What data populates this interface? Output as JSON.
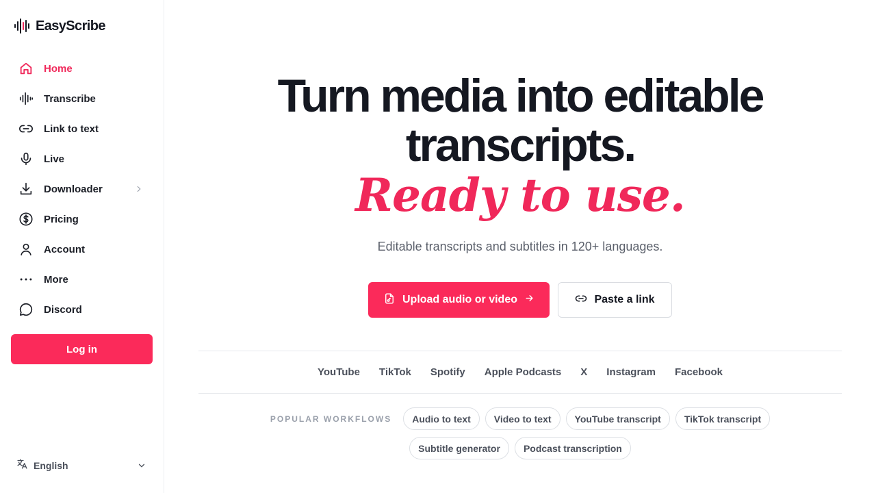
{
  "brand": {
    "name": "EasyScribe",
    "accent": "#fb2a5a"
  },
  "sidebar": {
    "items": [
      {
        "label": "Home",
        "icon": "home-icon",
        "active": true
      },
      {
        "label": "Transcribe",
        "icon": "waveform-icon"
      },
      {
        "label": "Link to text",
        "icon": "link-icon"
      },
      {
        "label": "Live",
        "icon": "microphone-icon"
      },
      {
        "label": "Downloader",
        "icon": "download-icon",
        "has_submenu": true
      },
      {
        "label": "Pricing",
        "icon": "dollar-circle-icon"
      },
      {
        "label": "Account",
        "icon": "user-icon"
      },
      {
        "label": "More",
        "icon": "more-dots-icon"
      },
      {
        "label": "Discord",
        "icon": "chat-bubble-icon"
      }
    ],
    "login_label": "Log in",
    "language": "English"
  },
  "hero": {
    "line1": "Turn media into editable",
    "line2": "transcripts.",
    "tagline": "Ready to use.",
    "subtitle": "Editable transcripts and subtitles in 120+ languages."
  },
  "cta": {
    "upload_label": "Upload audio or video",
    "paste_label": "Paste a link"
  },
  "platforms": [
    "YouTube",
    "TikTok",
    "Spotify",
    "Apple Podcasts",
    "X",
    "Instagram",
    "Facebook"
  ],
  "workflows": {
    "label": "POPULAR WORKFLOWS",
    "items": [
      "Audio to text",
      "Video to text",
      "YouTube transcript",
      "TikTok transcript",
      "Subtitle generator",
      "Podcast transcription"
    ]
  }
}
